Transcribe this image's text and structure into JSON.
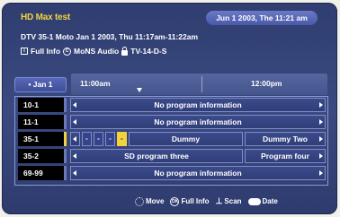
{
  "header": {
    "title": "HD Max test",
    "datetime": "Jun 1 2003, The 11:21 am",
    "program_line": "DTV 35-1 Moto Jan 1 2003, Thu  11:17am-11:22am",
    "info_full": "Full Info",
    "info_audio": "MoNS Audio",
    "info_rating": "TV-14-D-S"
  },
  "timebar": {
    "date": "• Jan 1",
    "slot1": "11:00am",
    "slot2": "12:00pm"
  },
  "rows": [
    {
      "channel": "10-1",
      "cells": [
        "No program information"
      ]
    },
    {
      "channel": "11-1",
      "cells": [
        "No program information"
      ]
    },
    {
      "channel": "35-1",
      "cells": [
        "Dummy",
        "Dummy Two"
      ],
      "mini": [
        "-",
        "-",
        "-",
        "-"
      ]
    },
    {
      "channel": "35-2",
      "cells": [
        "SD program three",
        "Program four"
      ]
    },
    {
      "channel": "69-99",
      "cells": [
        "No program information"
      ]
    }
  ],
  "footer": {
    "move": "Move",
    "full_info": "Full Info",
    "scan": "Scan",
    "date": "Date"
  },
  "colors": {
    "accent": "#f3d33c",
    "panel": "#34438a",
    "channel_bg": "#000000"
  }
}
